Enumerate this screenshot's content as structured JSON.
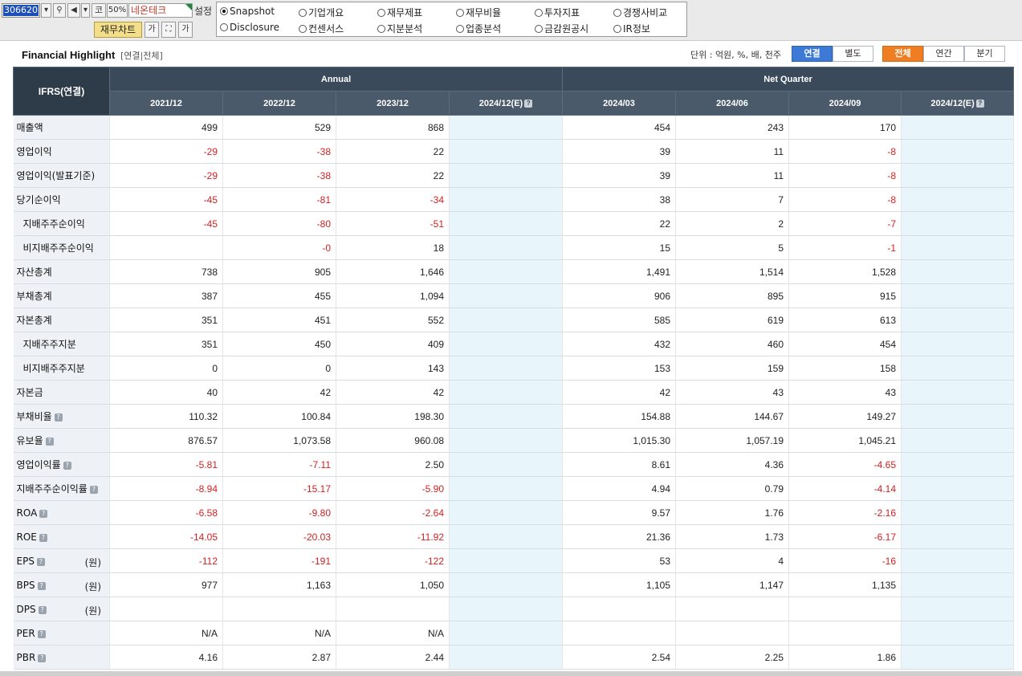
{
  "toolbar": {
    "code": "306620",
    "zoom": "50%",
    "ko_btn": "코",
    "stock_name": "네온테크",
    "setting_label": "설정",
    "chart_button": "재무차트",
    "font_small": "가",
    "font_large": "가"
  },
  "menu": {
    "items": [
      {
        "label": "Snapshot",
        "selected": true
      },
      {
        "label": "기업개요",
        "selected": false
      },
      {
        "label": "재무제표",
        "selected": false
      },
      {
        "label": "재무비율",
        "selected": false
      },
      {
        "label": "투자지표",
        "selected": false
      },
      {
        "label": "경쟁사비교",
        "selected": false
      },
      {
        "label": "Disclosure",
        "selected": false
      },
      {
        "label": "컨센서스",
        "selected": false
      },
      {
        "label": "지분분석",
        "selected": false
      },
      {
        "label": "업종분석",
        "selected": false
      },
      {
        "label": "금감원공시",
        "selected": false
      },
      {
        "label": "IR정보",
        "selected": false
      }
    ]
  },
  "highlight": {
    "title": "Financial Highlight",
    "subtitle": "[연결|전체]",
    "unit": "단위 : 억원, %, 배, 천주",
    "btn_consolidated": "연결",
    "btn_separate": "별도",
    "btn_all": "전체",
    "btn_annual": "연간",
    "btn_quarter": "분기"
  },
  "table": {
    "corner": "IFRS(연결)",
    "annual_header": "Annual",
    "quarter_header": "Net Quarter",
    "periods": [
      "2021/12",
      "2022/12",
      "2023/12",
      "2024/12(E)",
      "2024/03",
      "2024/06",
      "2024/09",
      "2024/12(E)"
    ],
    "help_glyph": "?",
    "won_label": "(원)",
    "rows": [
      {
        "label": "매출액",
        "indent": false,
        "help": false,
        "won": false,
        "values": [
          "499",
          "529",
          "868",
          "",
          "454",
          "243",
          "170",
          ""
        ]
      },
      {
        "label": "영업이익",
        "indent": false,
        "help": false,
        "won": false,
        "values": [
          "-29",
          "-38",
          "22",
          "",
          "39",
          "11",
          "-8",
          ""
        ]
      },
      {
        "label": "영업이익(발표기준)",
        "indent": false,
        "help": false,
        "won": false,
        "values": [
          "-29",
          "-38",
          "22",
          "",
          "39",
          "11",
          "-8",
          ""
        ]
      },
      {
        "label": "당기순이익",
        "indent": false,
        "help": false,
        "won": false,
        "values": [
          "-45",
          "-81",
          "-34",
          "",
          "38",
          "7",
          "-8",
          ""
        ]
      },
      {
        "label": "지배주주순이익",
        "indent": true,
        "help": false,
        "won": false,
        "values": [
          "-45",
          "-80",
          "-51",
          "",
          "22",
          "2",
          "-7",
          ""
        ]
      },
      {
        "label": "비지배주주순이익",
        "indent": true,
        "help": false,
        "won": false,
        "values": [
          "",
          "-0",
          "18",
          "",
          "15",
          "5",
          "-1",
          ""
        ]
      },
      {
        "label": "자산총계",
        "indent": false,
        "help": false,
        "won": false,
        "values": [
          "738",
          "905",
          "1,646",
          "",
          "1,491",
          "1,514",
          "1,528",
          ""
        ]
      },
      {
        "label": "부채총계",
        "indent": false,
        "help": false,
        "won": false,
        "values": [
          "387",
          "455",
          "1,094",
          "",
          "906",
          "895",
          "915",
          ""
        ]
      },
      {
        "label": "자본총계",
        "indent": false,
        "help": false,
        "won": false,
        "values": [
          "351",
          "451",
          "552",
          "",
          "585",
          "619",
          "613",
          ""
        ]
      },
      {
        "label": "지배주주지분",
        "indent": true,
        "help": false,
        "won": false,
        "values": [
          "351",
          "450",
          "409",
          "",
          "432",
          "460",
          "454",
          ""
        ]
      },
      {
        "label": "비지배주주지분",
        "indent": true,
        "help": false,
        "won": false,
        "values": [
          "0",
          "0",
          "143",
          "",
          "153",
          "159",
          "158",
          ""
        ]
      },
      {
        "label": "자본금",
        "indent": false,
        "help": false,
        "won": false,
        "values": [
          "40",
          "42",
          "42",
          "",
          "42",
          "43",
          "43",
          ""
        ]
      },
      {
        "label": "부채비율",
        "indent": false,
        "help": true,
        "won": false,
        "values": [
          "110.32",
          "100.84",
          "198.30",
          "",
          "154.88",
          "144.67",
          "149.27",
          ""
        ]
      },
      {
        "label": "유보율",
        "indent": false,
        "help": true,
        "won": false,
        "values": [
          "876.57",
          "1,073.58",
          "960.08",
          "",
          "1,015.30",
          "1,057.19",
          "1,045.21",
          ""
        ]
      },
      {
        "label": "영업이익률",
        "indent": false,
        "help": true,
        "won": false,
        "values": [
          "-5.81",
          "-7.11",
          "2.50",
          "",
          "8.61",
          "4.36",
          "-4.65",
          ""
        ]
      },
      {
        "label": "지배주주순이익률",
        "indent": false,
        "help": true,
        "won": false,
        "values": [
          "-8.94",
          "-15.17",
          "-5.90",
          "",
          "4.94",
          "0.79",
          "-4.14",
          ""
        ]
      },
      {
        "label": "ROA",
        "indent": false,
        "help": true,
        "won": false,
        "values": [
          "-6.58",
          "-9.80",
          "-2.64",
          "",
          "9.57",
          "1.76",
          "-2.16",
          ""
        ]
      },
      {
        "label": "ROE",
        "indent": false,
        "help": true,
        "won": false,
        "values": [
          "-14.05",
          "-20.03",
          "-11.92",
          "",
          "21.36",
          "1.73",
          "-6.17",
          ""
        ]
      },
      {
        "label": "EPS",
        "indent": false,
        "help": true,
        "won": true,
        "values": [
          "-112",
          "-191",
          "-122",
          "",
          "53",
          "4",
          "-16",
          ""
        ]
      },
      {
        "label": "BPS",
        "indent": false,
        "help": true,
        "won": true,
        "values": [
          "977",
          "1,163",
          "1,050",
          "",
          "1,105",
          "1,147",
          "1,135",
          ""
        ]
      },
      {
        "label": "DPS",
        "indent": false,
        "help": true,
        "won": true,
        "values": [
          "",
          "",
          "",
          "",
          "",
          "",
          "",
          ""
        ]
      },
      {
        "label": "PER",
        "indent": false,
        "help": true,
        "won": false,
        "values": [
          "N/A",
          "N/A",
          "N/A",
          "",
          "",
          "",
          "",
          ""
        ]
      },
      {
        "label": "PBR",
        "indent": false,
        "help": true,
        "won": false,
        "values": [
          "4.16",
          "2.87",
          "2.44",
          "",
          "2.54",
          "2.25",
          "1.86",
          ""
        ]
      }
    ]
  }
}
